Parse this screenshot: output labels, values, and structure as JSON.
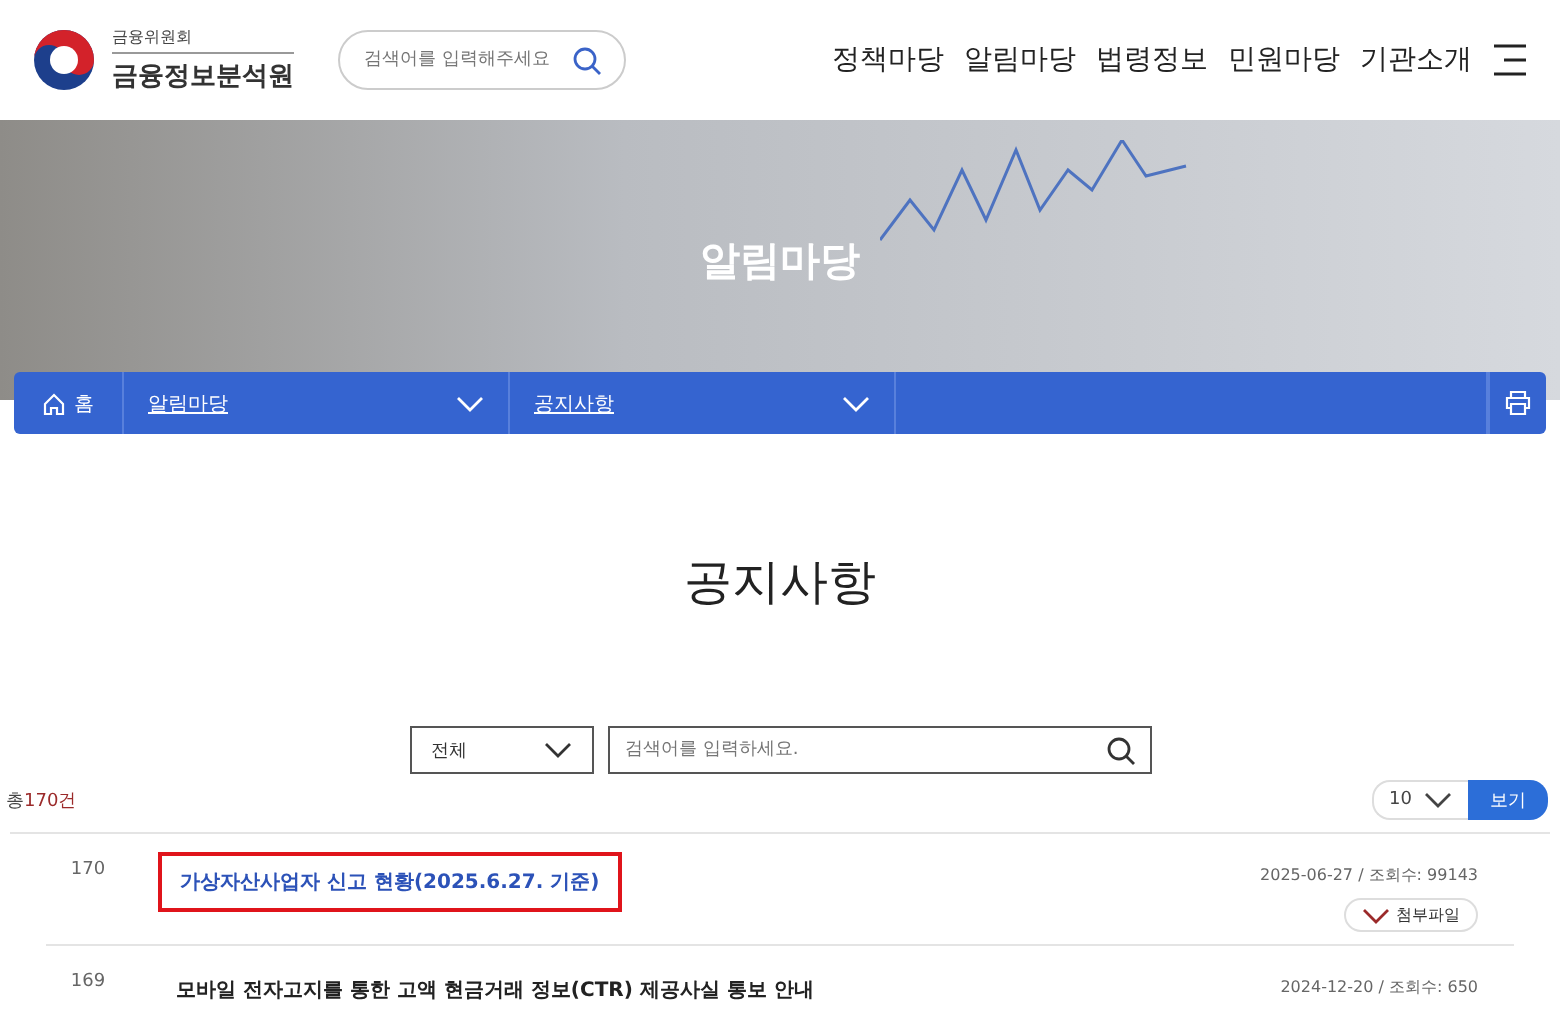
{
  "header": {
    "org_small": "금융위원회",
    "org_name": "금융정보분석원",
    "search_placeholder": "검색어를 입력해주세요",
    "nav": [
      "정책마당",
      "알림마당",
      "법령정보",
      "민원마당",
      "기관소개"
    ]
  },
  "hero": {
    "title": "알림마당"
  },
  "breadcrumb": {
    "home": "홈",
    "items": [
      "알림마당",
      "공지사항"
    ]
  },
  "page_title": "공지사항",
  "filter": {
    "category": "전체",
    "placeholder": "검색어를 입력하세요."
  },
  "total": {
    "prefix": "총",
    "count": "170건"
  },
  "page_size": "10",
  "view_button": "보기",
  "rows": [
    {
      "number": "170",
      "title": "가상자산사업자 신고 현황(2025.6.27. 기준)",
      "meta": "2025-06-27 / 조회수: 99143",
      "attachment": "첨부파일",
      "highlighted": true
    },
    {
      "number": "169",
      "title": "모바일 전자고지를 통한 고액 현금거래 정보(CTR) 제공사실 통보 안내",
      "meta": "2024-12-20 / 조회수: 650",
      "highlighted": false
    }
  ]
}
